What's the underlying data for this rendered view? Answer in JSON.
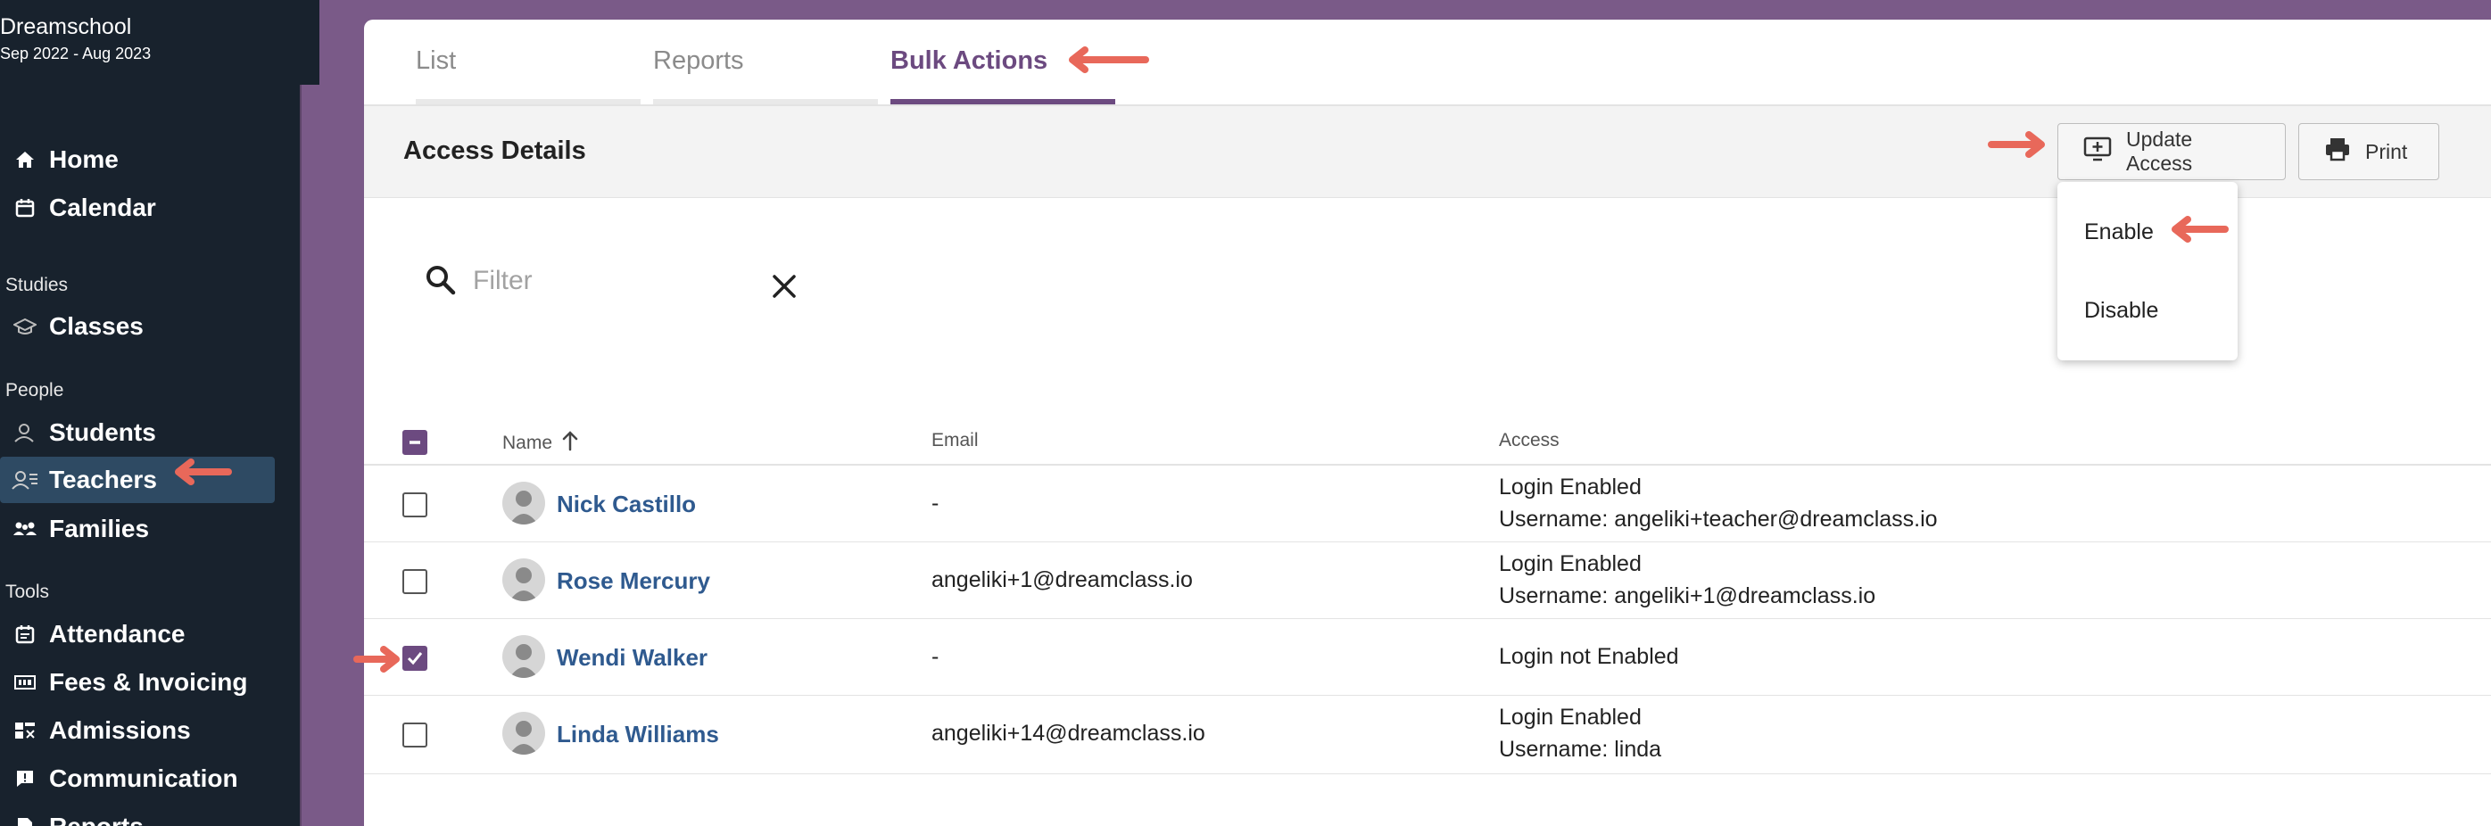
{
  "school": {
    "name": "Dreamschool",
    "year": "Sep 2022 - Aug 2023"
  },
  "sidebar": {
    "items": [
      {
        "label": "Home",
        "icon": "home-icon"
      },
      {
        "label": "Calendar",
        "icon": "calendar-icon"
      }
    ],
    "sections": [
      {
        "title": "Studies",
        "items": [
          {
            "label": "Classes",
            "icon": "graduation-cap-icon"
          }
        ]
      },
      {
        "title": "People",
        "items": [
          {
            "label": "Students",
            "icon": "student-icon"
          },
          {
            "label": "Teachers",
            "icon": "teacher-icon",
            "active": true
          },
          {
            "label": "Families",
            "icon": "family-icon"
          }
        ]
      },
      {
        "title": "Tools",
        "items": [
          {
            "label": "Attendance",
            "icon": "attendance-icon"
          },
          {
            "label": "Fees & Invoicing",
            "icon": "invoice-icon"
          },
          {
            "label": "Admissions",
            "icon": "admissions-icon"
          },
          {
            "label": "Communication",
            "icon": "chat-icon"
          },
          {
            "label": "Reports",
            "icon": "reports-icon"
          }
        ]
      }
    ]
  },
  "tabs": [
    {
      "label": "List"
    },
    {
      "label": "Reports"
    },
    {
      "label": "Bulk Actions",
      "active": true
    }
  ],
  "toolbar": {
    "title": "Access Details",
    "update_access_label": "Update Access",
    "print_label": "Print"
  },
  "dropdown": {
    "items": [
      "Enable",
      "Disable"
    ]
  },
  "filter": {
    "placeholder": "Filter",
    "value": ""
  },
  "table": {
    "columns": [
      "Name",
      "Email",
      "Access"
    ],
    "sort": {
      "column": "Name",
      "direction": "ascending"
    },
    "rows": [
      {
        "name": "Nick Castillo",
        "email": "-",
        "access_line1": "Login Enabled",
        "access_line2": "Username: angeliki+teacher@dreamclass.io",
        "checked": false
      },
      {
        "name": "Rose Mercury",
        "email": "angeliki+1@dreamclass.io",
        "access_line1": "Login Enabled",
        "access_line2": "Username: angeliki+1@dreamclass.io",
        "checked": false
      },
      {
        "name": "Wendi Walker",
        "email": "-",
        "access_line1": "Login not Enabled",
        "access_line2": "",
        "checked": true
      },
      {
        "name": "Linda Williams",
        "email": "angeliki+14@dreamclass.io",
        "access_line1": "Login Enabled",
        "access_line2": "Username: linda",
        "checked": false
      }
    ]
  },
  "colors": {
    "accent": "#6c4a80",
    "sidebar_bg": "#18222d",
    "active_nav": "#2e4a63",
    "link": "#2f5a8f",
    "annotation_arrow": "#e8685a"
  }
}
